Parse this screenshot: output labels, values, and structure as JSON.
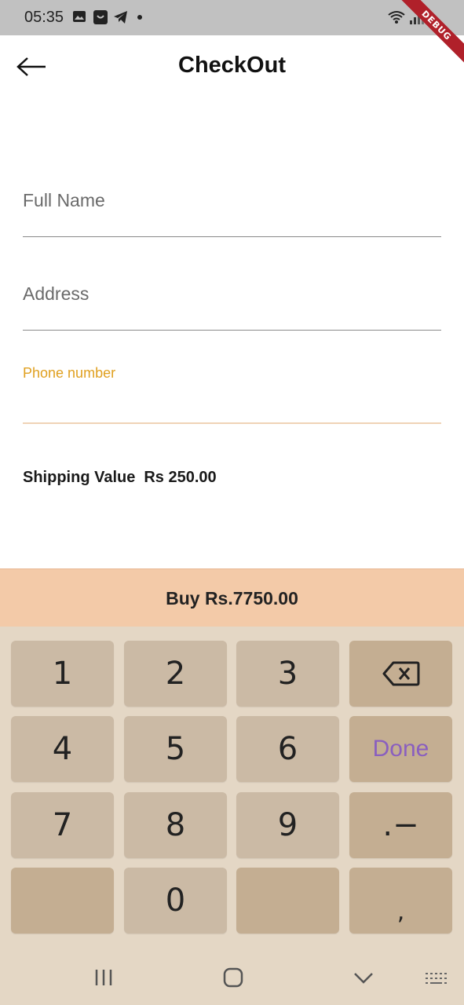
{
  "status_bar": {
    "time": "05:35",
    "debug_label": "DEBUG",
    "icons": [
      "image-icon",
      "app-icon",
      "telegram-icon",
      "dot-icon",
      "wifi-icon",
      "signal-icon",
      "battery-icon"
    ]
  },
  "header": {
    "title": "CheckOut",
    "back_icon": "arrow-left-icon"
  },
  "form": {
    "full_name": {
      "label": "Full Name",
      "value": ""
    },
    "address": {
      "label": "Address",
      "value": ""
    },
    "phone": {
      "label": "Phone number",
      "value": "",
      "focused": true
    }
  },
  "shipping": {
    "label": "Shipping Value",
    "value": "Rs 250.00"
  },
  "buy_button": {
    "label": "Buy Rs.7750.00"
  },
  "keyboard": {
    "keys": [
      "1",
      "2",
      "3",
      "backspace",
      "4",
      "5",
      "6",
      "Done",
      "7",
      "8",
      "9",
      ".−",
      "",
      "0",
      "",
      ","
    ],
    "done_label": "Done"
  },
  "colors": {
    "status_bar": "#c1c1c1",
    "focus_label": "#e0a020",
    "buy_bar": "#f3caa8",
    "keyboard_bg": "#e4d7c5",
    "key_light": "#cbbaa5",
    "key_dark": "#c4ae92",
    "done_text": "#8a5fbf"
  },
  "nav_bar": {
    "items": [
      "recent-apps-icon",
      "home-icon",
      "back-chevron-icon",
      "keyboard-icon"
    ]
  }
}
